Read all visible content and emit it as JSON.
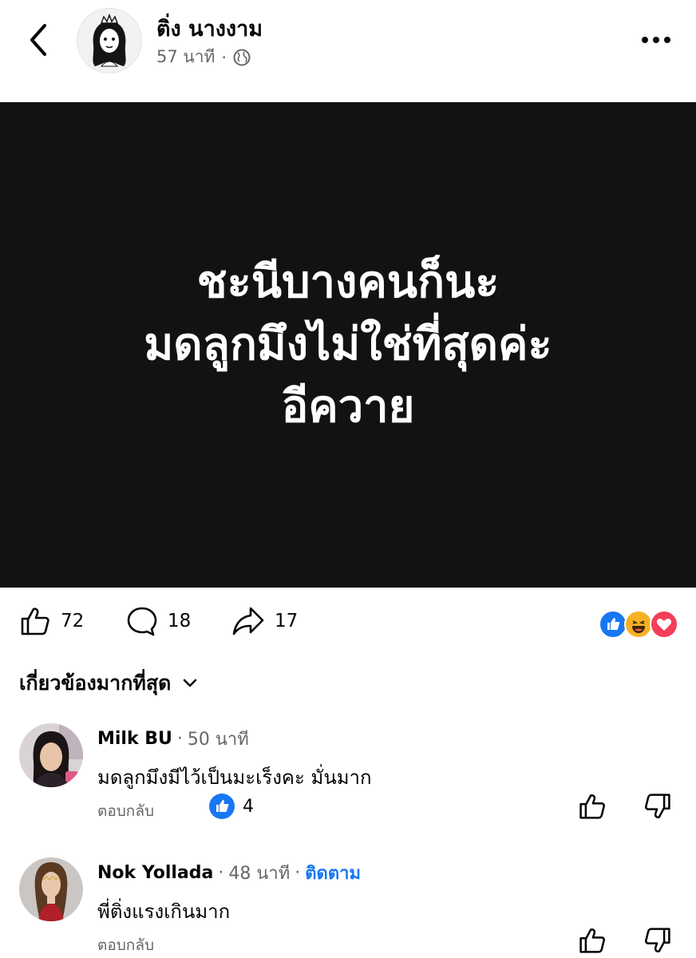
{
  "header": {
    "author_name": "ติ่ง นางงาม",
    "post_time": "57 นาที",
    "separator": "·",
    "privacy_icon": "globe-icon",
    "back_icon": "chevron-left-icon",
    "more_icon": "more-horizontal-icon"
  },
  "post": {
    "lines": [
      "ชะนีบางคนก็นะ",
      "มดลูกมึงไม่ใช่ที่สุดค่ะ",
      "อีควาย"
    ],
    "background": "#121212"
  },
  "actions": {
    "like_count": "72",
    "comment_count": "18",
    "share_count": "17",
    "reaction_icons": [
      "like-reaction-icon",
      "haha-reaction-icon",
      "love-reaction-icon"
    ]
  },
  "sort": {
    "label": "เกี่ยวข้องมากที่สุด",
    "icon": "chevron-down-icon"
  },
  "comments": [
    {
      "name": "Milk BU",
      "time": "50 นาที",
      "text": "มดลูกมึงมีไว้เป็นมะเร็งคะ มั่นมาก",
      "reply_label": "ตอบกลับ",
      "like_count": "4"
    },
    {
      "name": "Nok Yollada",
      "time": "48 นาที",
      "follow_label": "ติดตาม",
      "text": "พี่ติ่งแรงเกินมาก",
      "reply_label": "ตอบกลับ"
    }
  ],
  "colors": {
    "accent": "#1877f2",
    "secondary_text": "#65676b",
    "like": "#1877f2",
    "love": "#f33e58",
    "haha": "#f7b125"
  }
}
